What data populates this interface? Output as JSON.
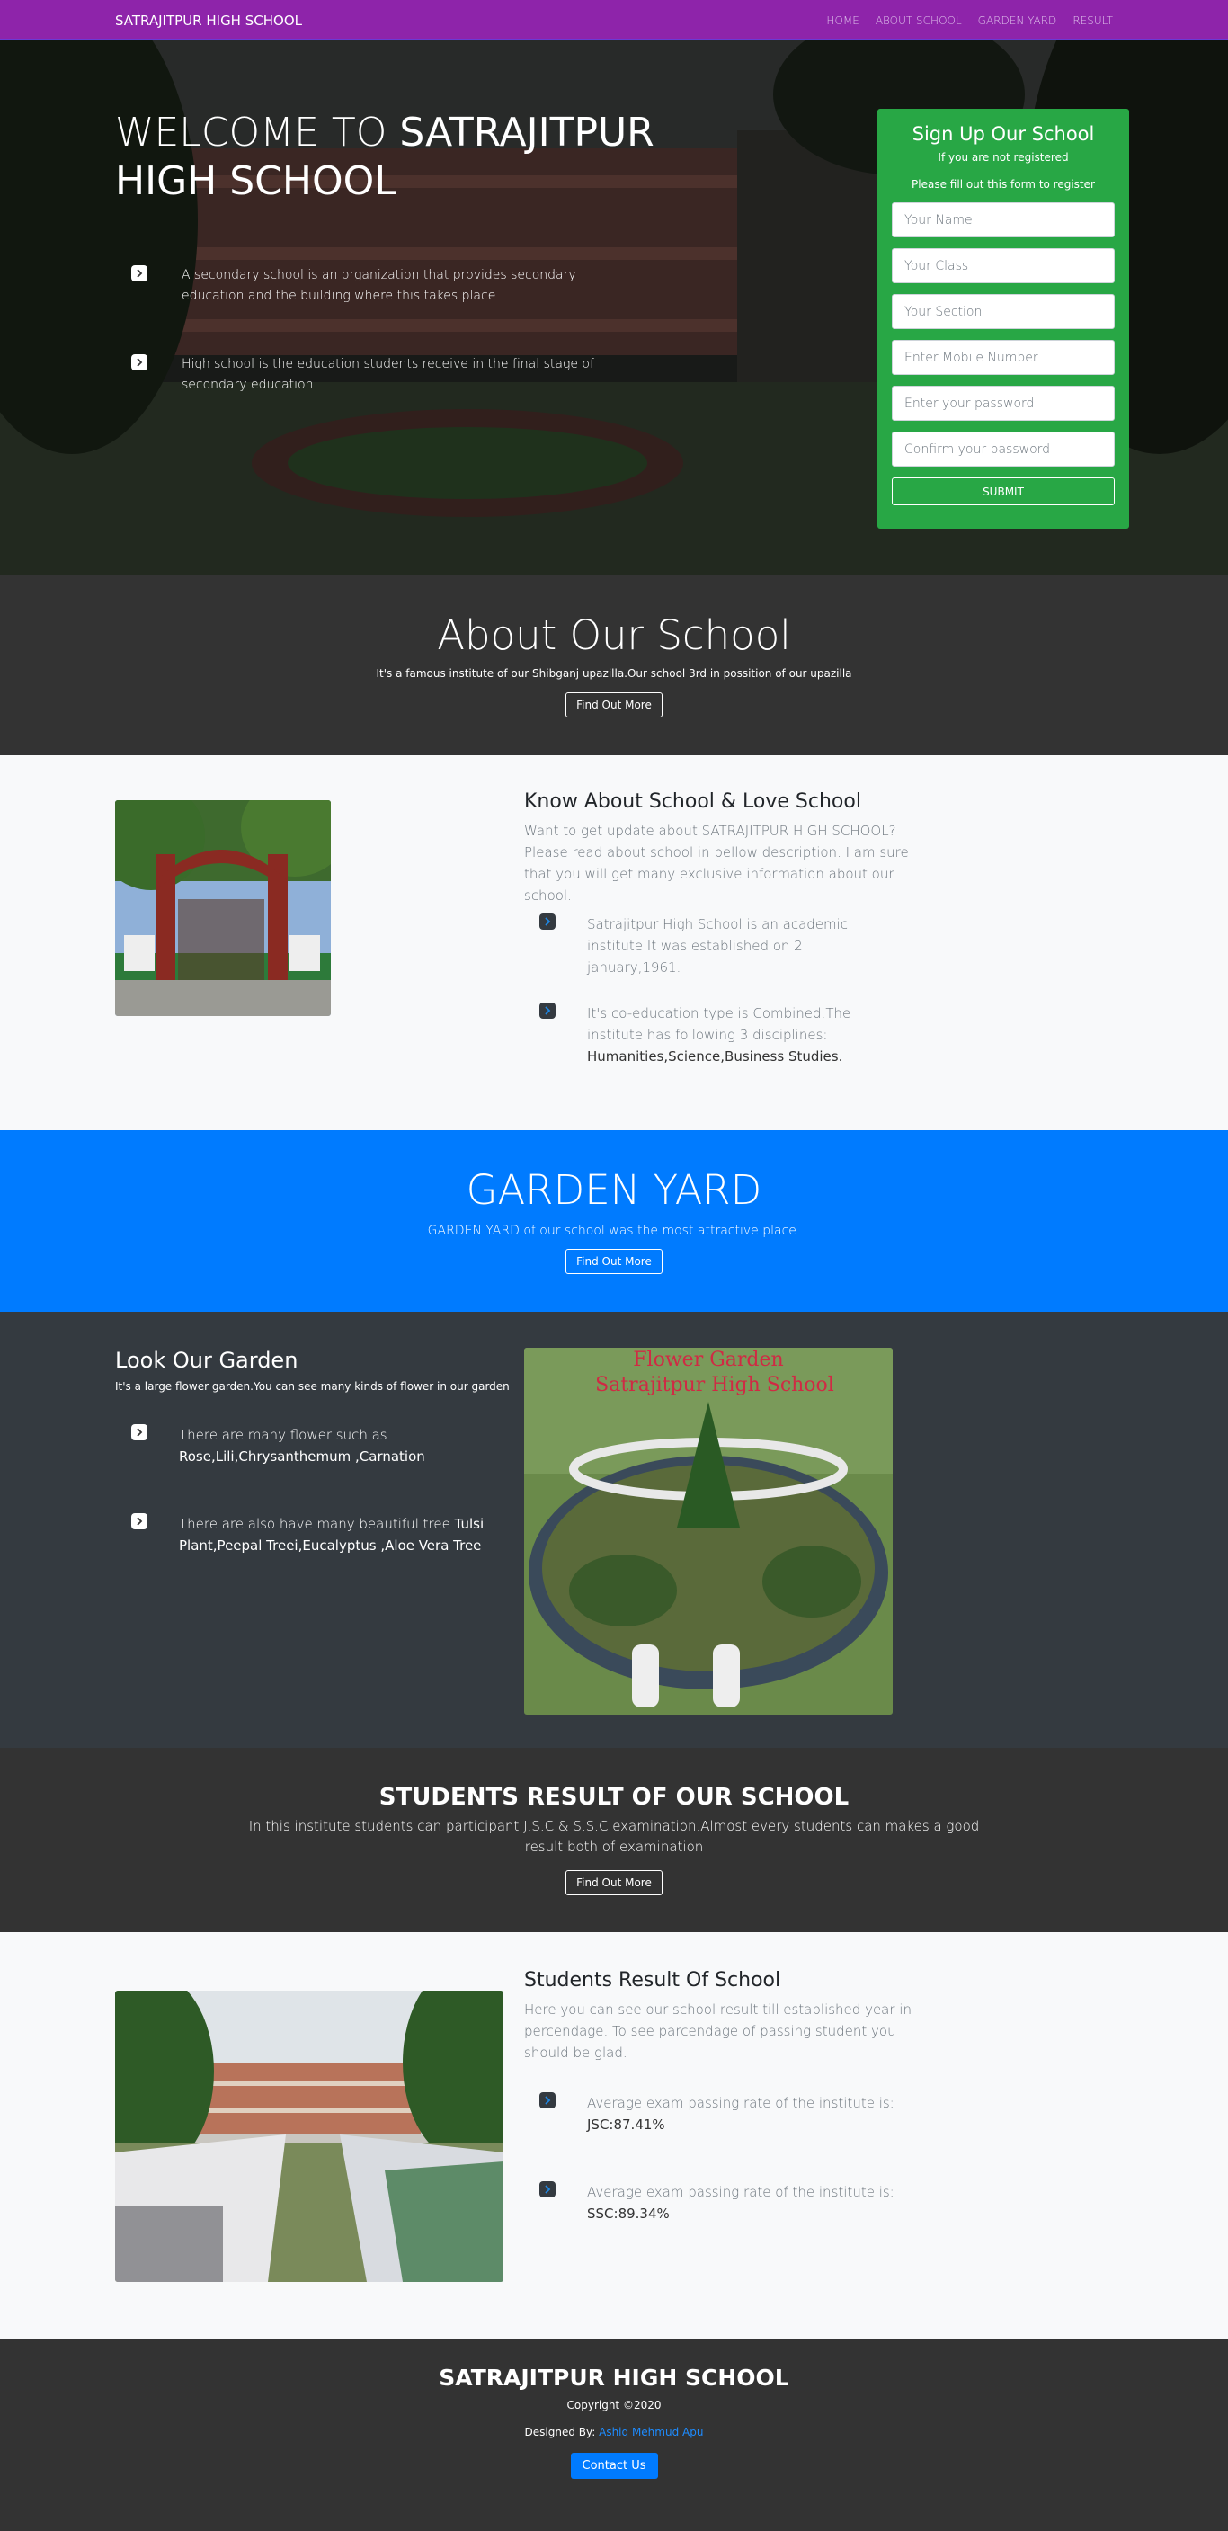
{
  "nav": {
    "brand": "SATRAJITPUR HIGH SCHOOL",
    "links": [
      "HOME",
      "ABOUT SCHOOL",
      "GARDEN YARD",
      "RESULT"
    ]
  },
  "hero": {
    "title_a": "WELCOME TO ",
    "title_b": "SATRAJITPUR HIGH SCHOOL",
    "features": [
      "A secondary school is an organization that provides secondary education and the building where this takes place.",
      "High school is the education students receive in the final stage of secondary education"
    ]
  },
  "signup": {
    "title": "Sign Up Our School",
    "sub1": "If you are not registered",
    "sub2": "Please fill out this form to register",
    "fields": [
      "Your Name",
      "Your Class",
      "Your Section",
      "Enter Mobile Number",
      "Enter your password",
      "Confirm your password"
    ],
    "submit": "SUBMIT"
  },
  "about": {
    "title": "About Our School",
    "text": "It's a famous institute of our Shibganj upazilla.Our school 3rd in possition of our upazilla",
    "button": "Find Out More"
  },
  "know": {
    "title": "Know About School & Love School",
    "lead": "Want to get update about SATRAJITPUR HIGH SCHOOL? Please read about school in bellow description. I am sure that you will get many exclusive information about our school.",
    "item1": "Satrajitpur High School is an academic institute.It was established on 2 january,1961.",
    "item2": "It's co-education type is Combined.The institute has following 3 disciplines:",
    "item2_bold": "Humanities,Science,Business Studies."
  },
  "garden_band": {
    "title": "GARDEN YARD",
    "text": "GARDEN YARD of our school was the most attractive place.",
    "button": "Find Out More"
  },
  "look": {
    "title": "Look Our Garden",
    "sub": "It's a large flower garden.You can see many kinds of flower in our garden",
    "item1": "There are many flower such as ",
    "item1_bold": "Rose,Lili,Chrysanthemum ,Carnation",
    "item2": "There are also have many beautiful tree ",
    "item2_bold": "Tulsi Plant,Peepal Treei,Eucalyptus ,Aloe Vera Tree",
    "photo_caption1": "Flower Garden",
    "photo_caption2": "Satrajitpur High School"
  },
  "result_band": {
    "title": "STUDENTS RESULT OF OUR SCHOOL",
    "text": "In this institute students can participant J.S.C & S.S.C examination.Almost every students can makes a good result both of examination",
    "button": "Find Out More"
  },
  "stud": {
    "title": "Students Result Of School",
    "lead": "Here you can see our school result till established year in percendage. To see parcendage of passing student you should be glad.",
    "item1": "Average exam passing rate of the institute is:",
    "item1_bold": "JSC:87.41%",
    "item2": "Average exam passing rate of the institute is:",
    "item2_bold": "SSC:89.34%"
  },
  "footer": {
    "title": "SATRAJITPUR HIGH SCHOOL",
    "copyright": "Copyright ©2020",
    "designed": "Designed By: ",
    "designer": "Ashiq Mehmud Apu",
    "button": "Contact Us"
  },
  "colors": {
    "nav": "#8e24aa",
    "signup": "#28a745",
    "blue": "#007bff",
    "dark": "#333333",
    "slate": "#343a40"
  }
}
